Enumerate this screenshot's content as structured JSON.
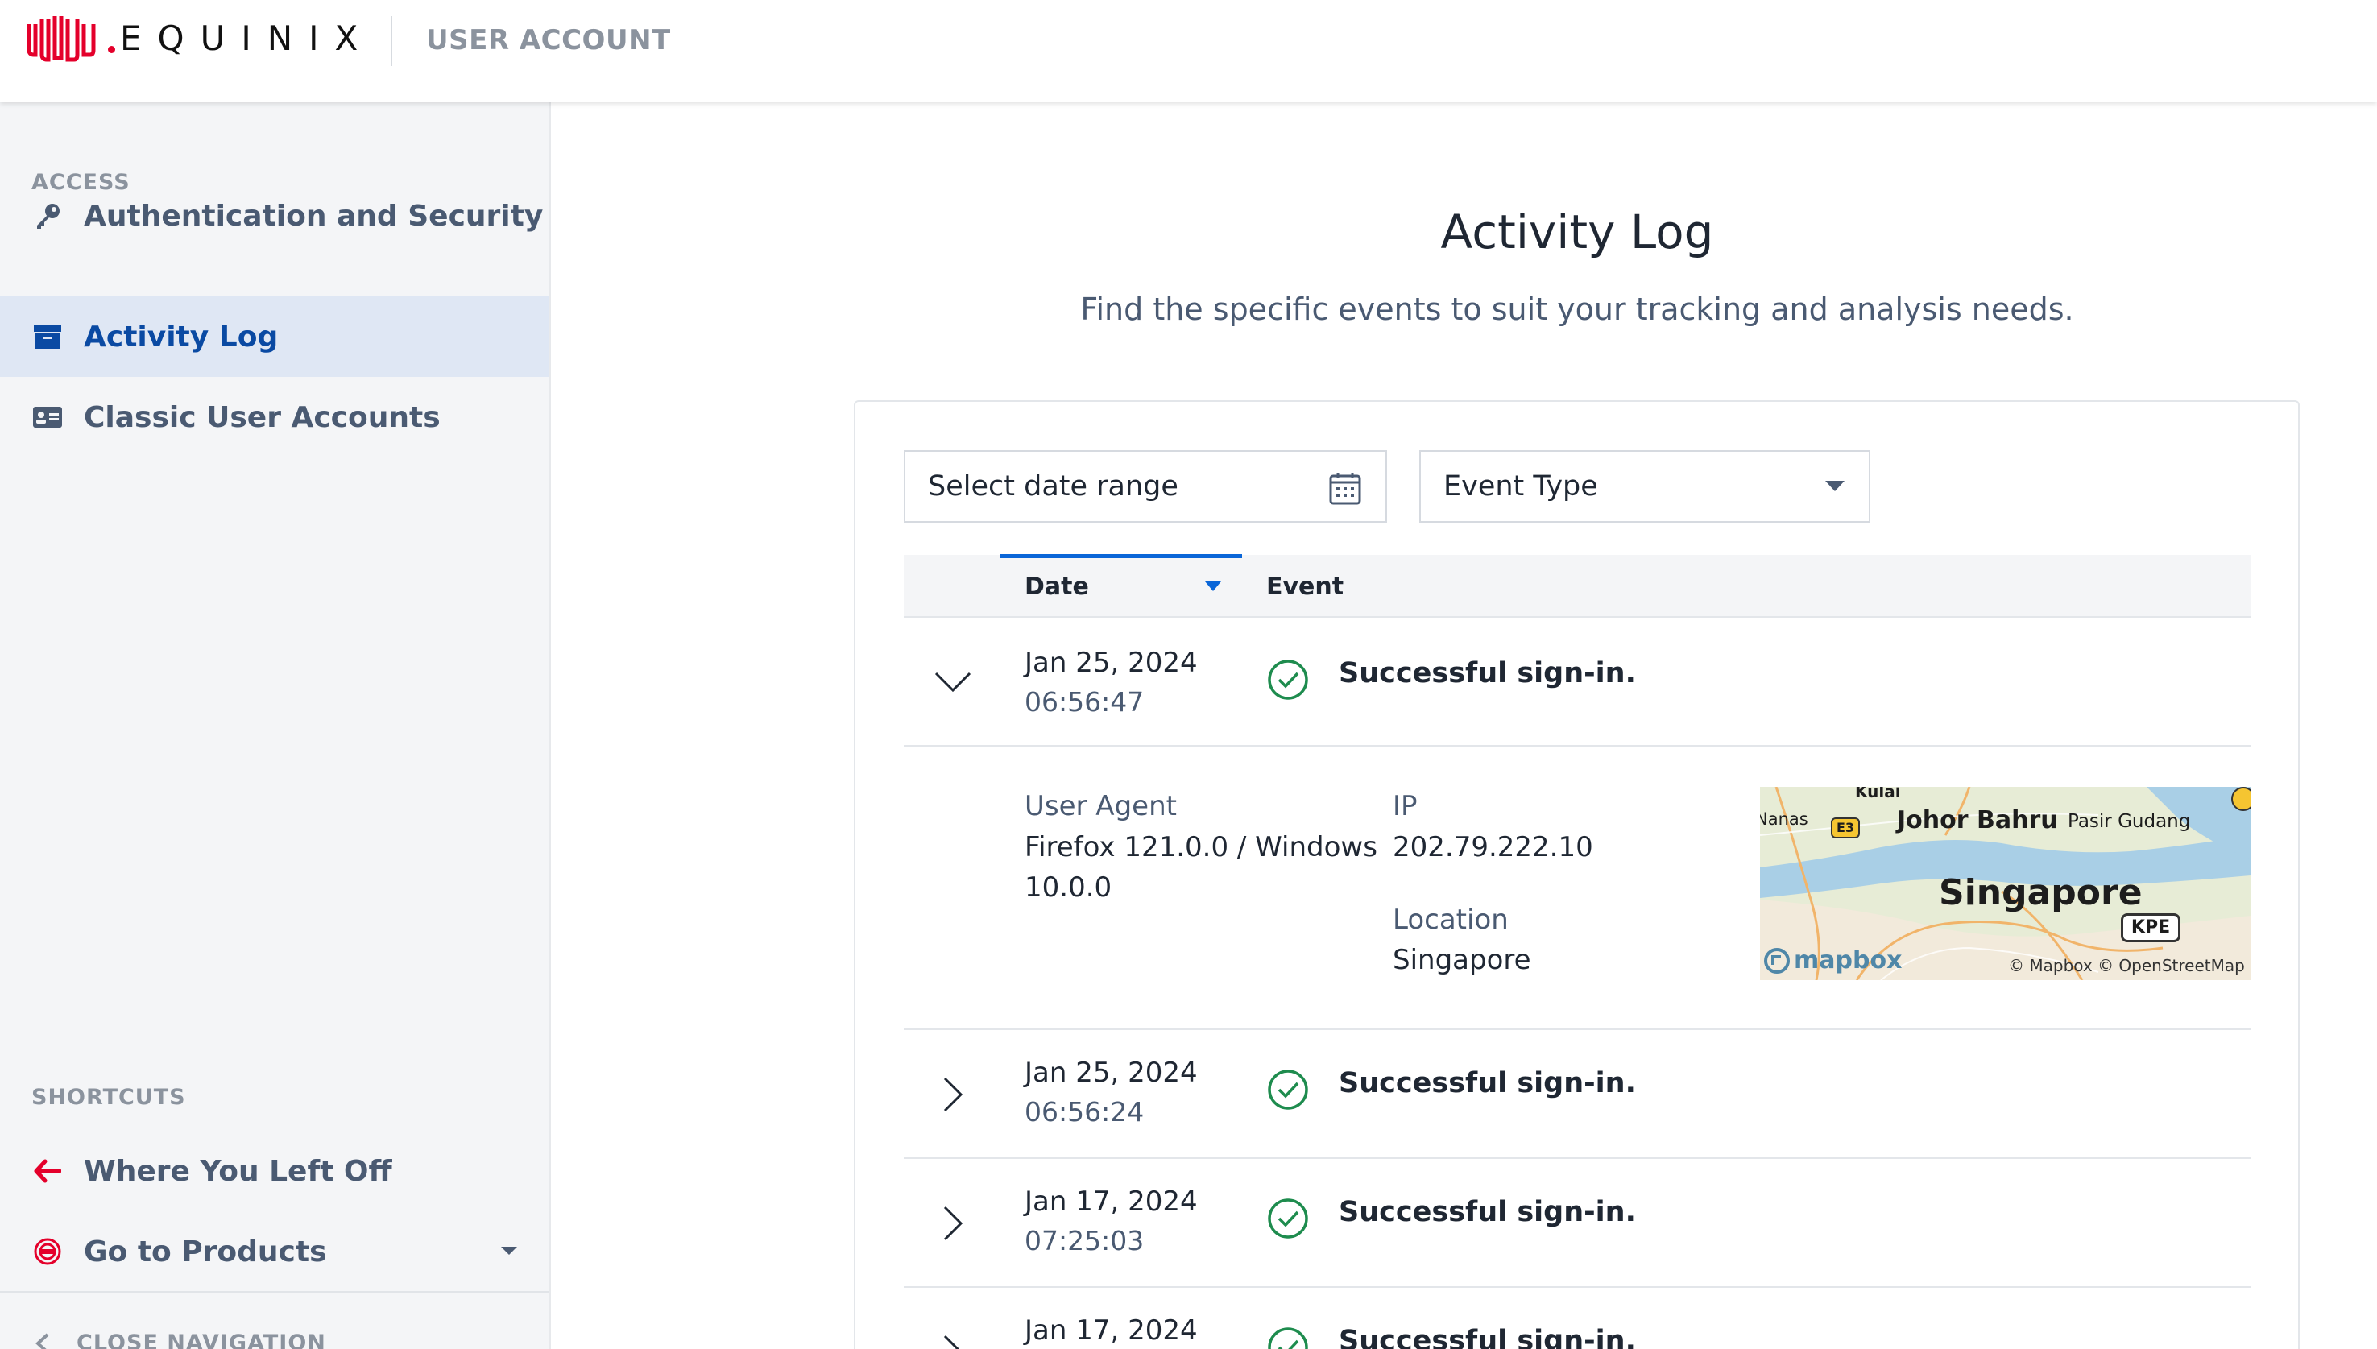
{
  "header": {
    "logo_text": "EQUINIX",
    "title": "USER ACCOUNT"
  },
  "sidebar": {
    "access_label": "ACCESS",
    "access_items": [
      {
        "label": "Authentication and Security",
        "icon": "key-icon",
        "active": false
      },
      {
        "label": "Activity Log",
        "icon": "archive-box-icon",
        "active": true
      },
      {
        "label": "Classic User Accounts",
        "icon": "id-card-icon",
        "active": false
      }
    ],
    "shortcuts_label": "SHORTCUTS",
    "shortcut_items": [
      {
        "label": "Where You Left Off",
        "icon": "arrow-left-icon"
      },
      {
        "label": "Go to Products",
        "icon": "products-icon"
      }
    ],
    "close_nav_label": "CLOSE NAVIGATION"
  },
  "main": {
    "title": "Activity Log",
    "subtitle": "Find the specific events to suit your tracking and analysis needs.",
    "filters": {
      "date_range_placeholder": "Select date range",
      "event_type_label": "Event Type"
    },
    "table": {
      "columns": [
        "Date",
        "Event"
      ],
      "rows": [
        {
          "date": "Jan 25, 2024",
          "time": "06:56:47",
          "event": "Successful sign-in.",
          "expanded": true
        },
        {
          "date": "Jan 25, 2024",
          "time": "06:56:24",
          "event": "Successful sign-in.",
          "expanded": false
        },
        {
          "date": "Jan 17, 2024",
          "time": "07:25:03",
          "event": "Successful sign-in.",
          "expanded": false
        },
        {
          "date": "Jan 17, 2024",
          "time": "",
          "event": "Successful sign-in.",
          "expanded": false
        }
      ],
      "detail": {
        "user_agent_label": "User Agent",
        "user_agent_line1": "Firefox 121.0.0 / Windows",
        "user_agent_line2": "10.0.0",
        "ip_label": "IP",
        "ip_value": "202.79.222.10",
        "location_label": "Location",
        "location_value": "Singapore",
        "map": {
          "city": "Singapore",
          "places": [
            "Johor Bahru",
            "Pasir Gudang",
            "Kulai",
            "Nanas"
          ],
          "road_badges": [
            "E3",
            "KPE"
          ],
          "brand": "mapbox",
          "attribution": "© Mapbox © OpenStreetMap"
        }
      }
    }
  },
  "colors": {
    "brand_red": "#e4002b",
    "active_blue": "#0a4aa3",
    "success_green": "#1e8c4e",
    "sort_blue": "#0a66d8"
  }
}
